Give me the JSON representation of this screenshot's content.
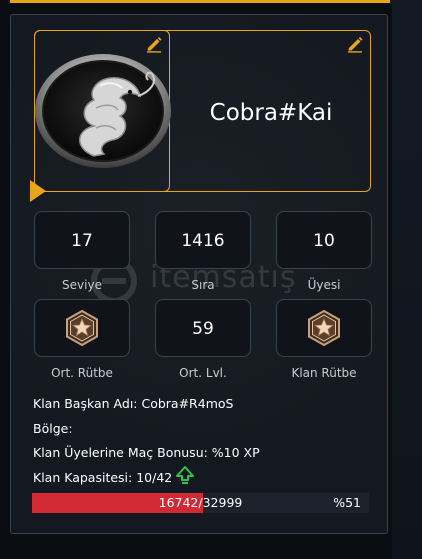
{
  "clan": {
    "name": "Cobra#Kai"
  },
  "stats": {
    "level": {
      "value": "17",
      "label": "Seviye"
    },
    "rank": {
      "value": "1416",
      "label": "Sıra"
    },
    "members": {
      "value": "10",
      "label": "Üyesi"
    },
    "avg_rank": {
      "label": "Ort. Rütbe"
    },
    "avg_level": {
      "value": "59",
      "label": "Ort. Lvl."
    },
    "clan_rank": {
      "label": "Klan Rütbe"
    }
  },
  "info": {
    "leader": "Klan Başkan Adı: Cobra#R4moS",
    "region": "Bölge:",
    "bonus": "Klan Üyelerine Maç Bonusu: %10 XP",
    "capacity": "Klan Kapasitesi: 10/42"
  },
  "progress": {
    "current_label": "16742/32999",
    "percent_label": "%51",
    "fraction": 0.507
  },
  "watermark": {
    "text": "itemsatış"
  },
  "colors": {
    "accent": "#e9a51a",
    "progress_fill": "#d22a34",
    "upgrade_arrow": "#2ec44a"
  },
  "icons": {
    "edit": "pencil-icon",
    "rank": "star-rank-badge-icon",
    "upgrade": "arrow-up-icon"
  }
}
